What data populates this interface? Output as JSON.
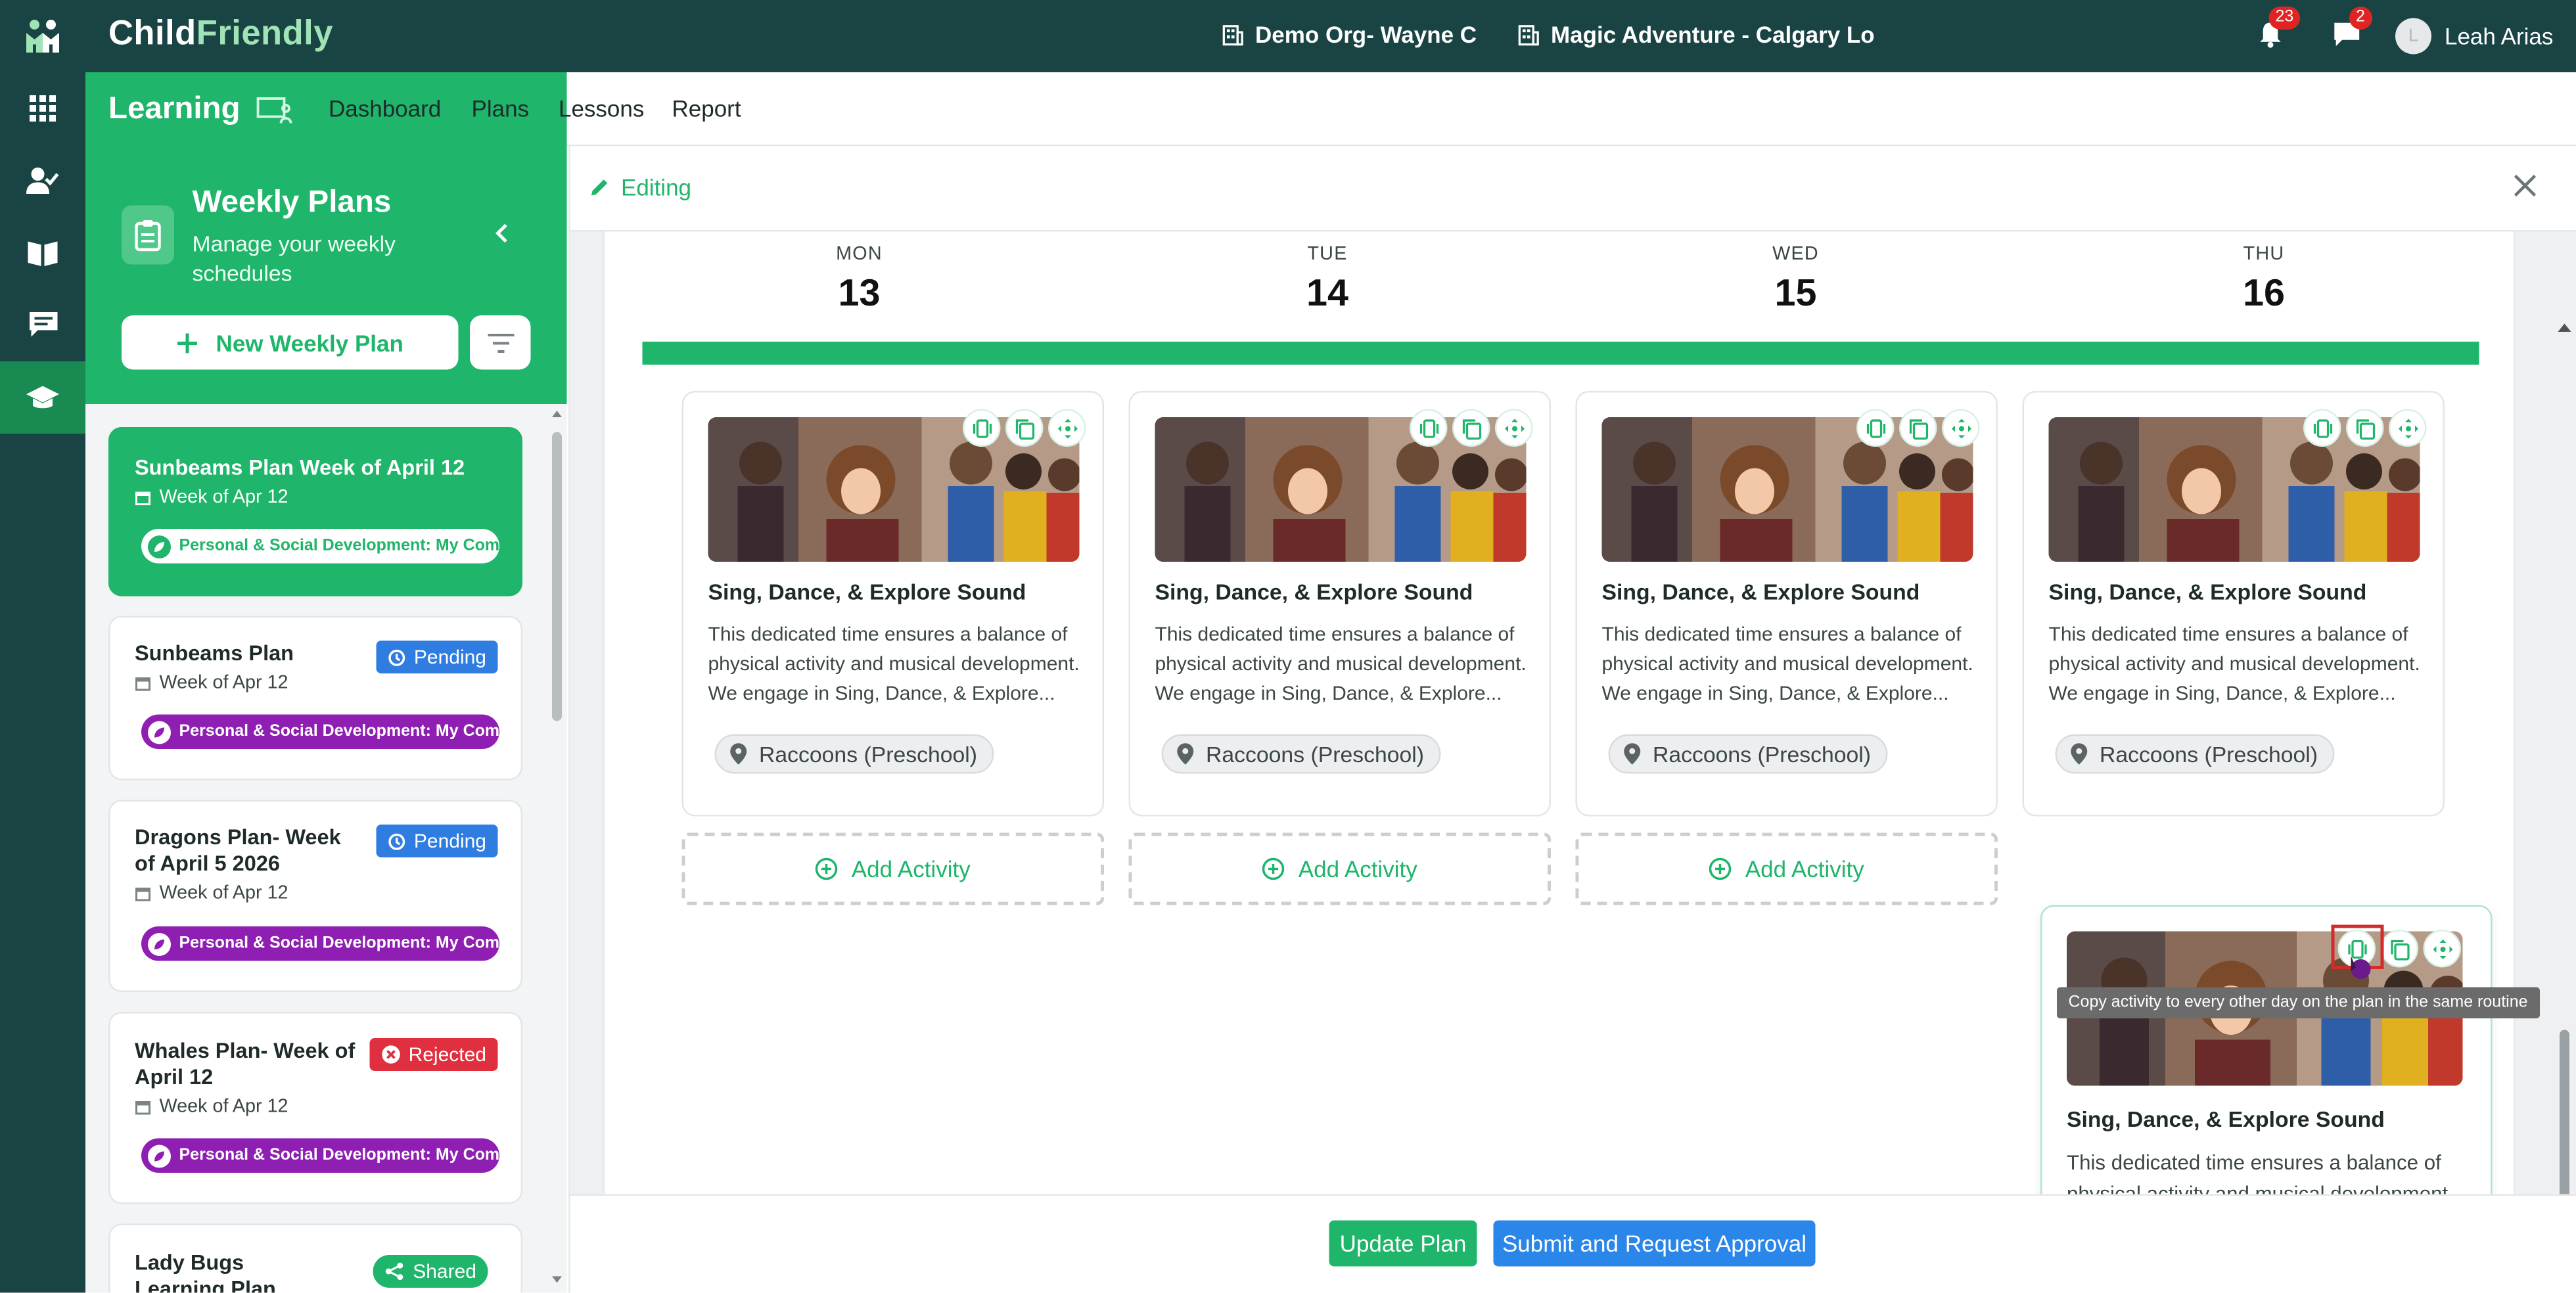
{
  "app": {
    "brand_part1": "Child",
    "brand_part2": "Friendly",
    "org": "Demo Org- Wayne C",
    "site": "Magic Adventure - Calgary Lo",
    "notifications_count": "23",
    "messages_count": "2",
    "user_initial": "L",
    "user_name": "Leah Arias"
  },
  "subnav": {
    "module": "Learning",
    "links": [
      "Dashboard",
      "Plans",
      "Lessons",
      "Report"
    ],
    "active": "Plans"
  },
  "sidebar": {
    "title": "Weekly Plans",
    "subtitle": "Manage your weekly schedules",
    "new_plan_label": "New Weekly Plan",
    "plans": [
      {
        "title": "Sunbeams Plan Week of April 12",
        "week": "Week of Apr 12",
        "tag": "Personal & Social Development: My Com...",
        "status": "",
        "selected": true
      },
      {
        "title": "Sunbeams Plan",
        "week": "Week of Apr 12",
        "tag": "Personal & Social Development: My Com...",
        "status": "Pending"
      },
      {
        "title": "Dragons Plan- Week of April 5 2026",
        "week": "Week of Apr 12",
        "tag": "Personal & Social Development: My Com...",
        "status": "Pending"
      },
      {
        "title": "Whales Plan- Week of April 12",
        "week": "Week of Apr 12",
        "tag": "Personal & Social Development: My Com...",
        "status": "Rejected"
      },
      {
        "title": "Lady Bugs Learning Plan",
        "week": "",
        "tag": "",
        "status": "Shared"
      }
    ]
  },
  "editor": {
    "mode_label": "Editing",
    "days": [
      {
        "name": "MON",
        "num": "13"
      },
      {
        "name": "TUE",
        "num": "14"
      },
      {
        "name": "WED",
        "num": "15"
      },
      {
        "name": "THU",
        "num": "16"
      }
    ],
    "activity": {
      "title": "Sing, Dance, & Explore Sound",
      "description": "This dedicated time ensures a balance of physical activity and musical development. We engage in Sing, Dance, & Explore...",
      "location": "Raccoons (Preschool)"
    },
    "add_activity_label": "Add Activity",
    "tooltip": "Copy activity to every other day on the plan in the same routine"
  },
  "footer": {
    "update_label": "Update Plan",
    "submit_label": "Submit and Request Approval"
  },
  "colors": {
    "topbar": "#1a4444",
    "accent_green": "#1fb56a",
    "pending_blue": "#2f7de1",
    "rejected_red": "#e02f3e",
    "tag_purple": "#8e1fb2"
  },
  "icons": [
    "apps-grid-icon",
    "user-check-icon",
    "book-open-icon",
    "chat-icon",
    "graduation-cap-icon",
    "bell-icon",
    "message-icon",
    "building-icon",
    "clipboard-icon",
    "chevron-left-icon",
    "plus-icon",
    "filter-icon",
    "calendar-icon",
    "leaf-icon",
    "pending-icon",
    "rejected-icon",
    "share-icon",
    "pencil-icon",
    "close-icon",
    "copy-all-days-icon",
    "duplicate-icon",
    "move-icon",
    "location-pin-icon",
    "plus-circle-icon"
  ]
}
